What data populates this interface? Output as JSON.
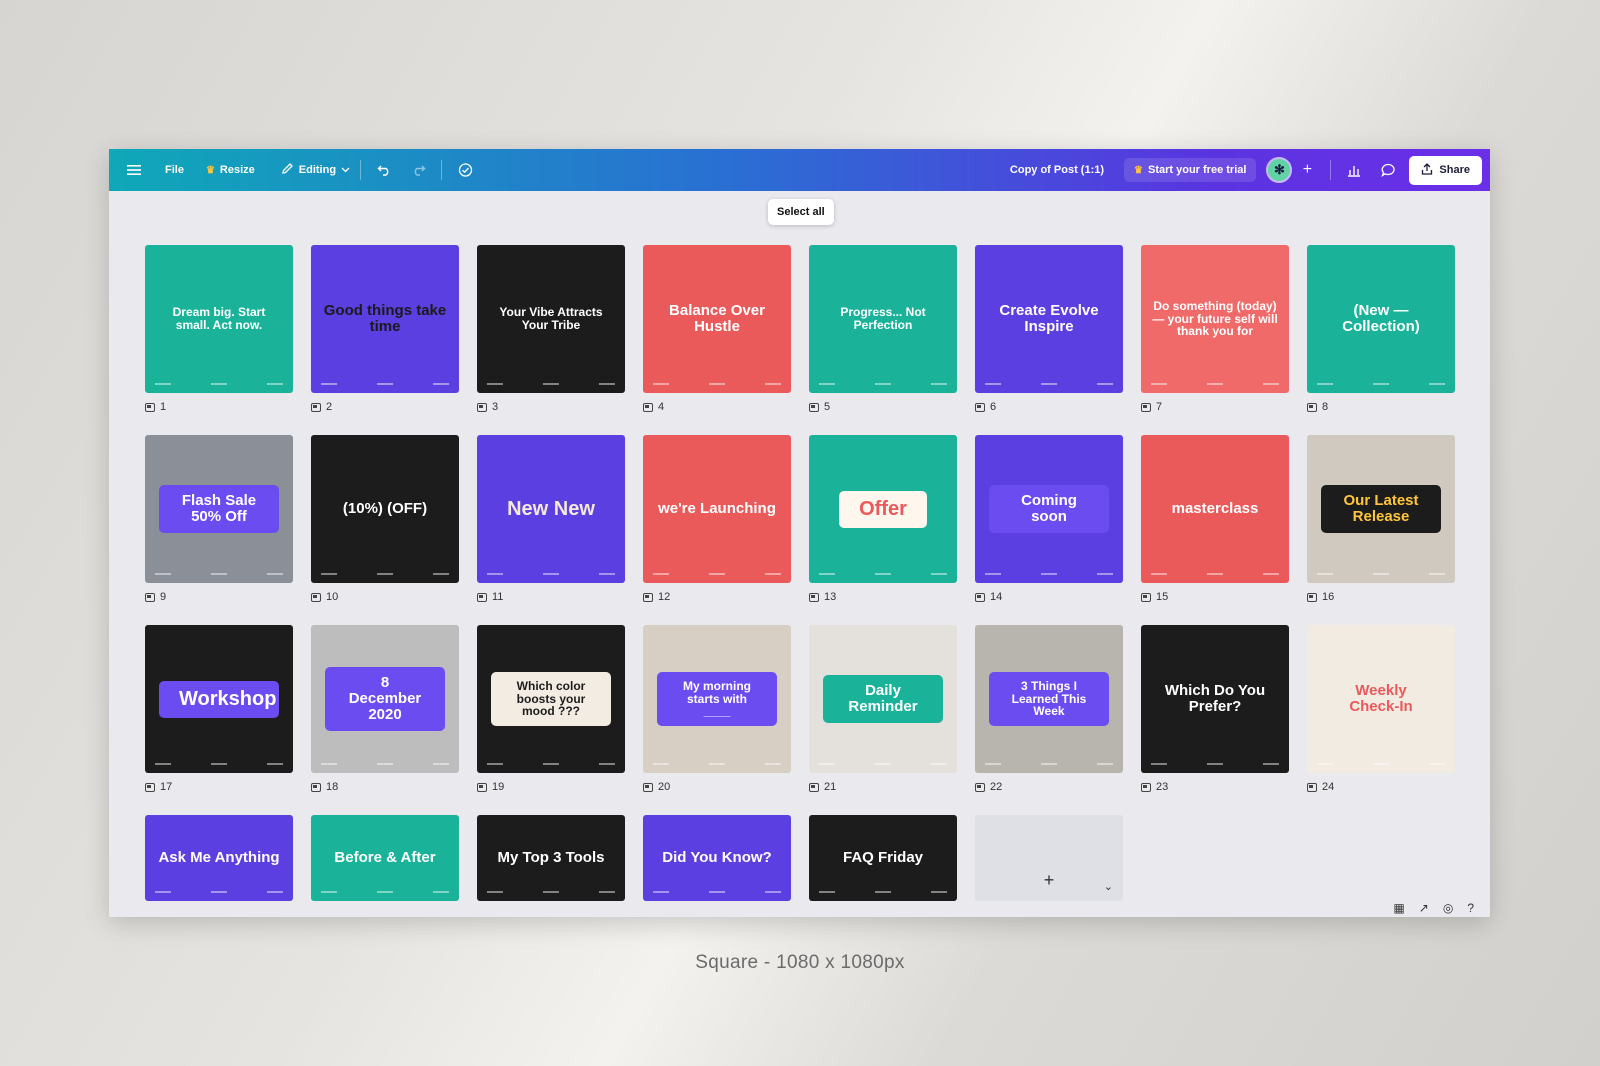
{
  "toolbar": {
    "file": "File",
    "resize": "Resize",
    "editing": "Editing",
    "doc_title": "Copy of Post (1:1)",
    "trial": "Start your free trial",
    "share": "Share"
  },
  "tooltip": "Select all",
  "pages": [
    {
      "num": "1",
      "bg": "#1ab39a",
      "fg": "#ffffff",
      "text": "Dream big. Start small. Act now."
    },
    {
      "num": "2",
      "bg": "#5b3fe0",
      "fg": "#1b1b1b",
      "text": "Good things take time"
    },
    {
      "num": "3",
      "bg": "#1c1c1c",
      "fg": "#ffffff",
      "text": "Your Vibe Attracts Your Tribe"
    },
    {
      "num": "4",
      "bg": "#ea5a5a",
      "fg": "#ffffff",
      "text": "Balance Over Hustle"
    },
    {
      "num": "5",
      "bg": "#1ab39a",
      "fg": "#ffffff",
      "text": "Progress... Not Perfection"
    },
    {
      "num": "6",
      "bg": "#5b3fe0",
      "fg": "#ffffff",
      "text": "Create Evolve Inspire"
    },
    {
      "num": "7",
      "bg": "#ef6a68",
      "fg": "#ffffff",
      "text": "Do something (today) — your future self will thank you for"
    },
    {
      "num": "8",
      "bg": "#1ab39a",
      "fg": "#ffffff",
      "text": "(New — Collection)"
    },
    {
      "num": "9",
      "bg": "#8a8f98",
      "fg": "#ffffff",
      "text": "Flash Sale 50% Off"
    },
    {
      "num": "10",
      "bg": "#1c1c1c",
      "fg": "#ffffff",
      "text": "(10%) (OFF)"
    },
    {
      "num": "11",
      "bg": "#5b3fe0",
      "fg": "#f3e9dc",
      "text": "New New"
    },
    {
      "num": "12",
      "bg": "#ea5a5a",
      "fg": "#ffffff",
      "text": "we're Launching"
    },
    {
      "num": "13",
      "bg": "#1ab39a",
      "fg": "#ea5a5a",
      "text": "Offer"
    },
    {
      "num": "14",
      "bg": "#5b3fe0",
      "fg": "#ffffff",
      "text": "Coming soon"
    },
    {
      "num": "15",
      "bg": "#ea5a5a",
      "fg": "#ffffff",
      "text": "masterclass"
    },
    {
      "num": "16",
      "bg": "#cfc9bf",
      "fg": "#ffc53d",
      "text": "Our Latest Release"
    },
    {
      "num": "17",
      "bg": "#1c1c1c",
      "fg": "#ffffff",
      "text": "Workshop"
    },
    {
      "num": "18",
      "bg": "#bdbdbd",
      "fg": "#ffffff",
      "text": "8 December 2020"
    },
    {
      "num": "19",
      "bg": "#1c1c1c",
      "fg": "#1c1c1c",
      "text": "Which color boosts your mood ???"
    },
    {
      "num": "20",
      "bg": "#d8cfc4",
      "fg": "#ffffff",
      "text": "My morning starts with ____"
    },
    {
      "num": "21",
      "bg": "#e4e0db",
      "fg": "#ffffff",
      "text": "Daily Reminder"
    },
    {
      "num": "22",
      "bg": "#b8b4ae",
      "fg": "#ffffff",
      "text": "3 Things I Learned This Week"
    },
    {
      "num": "23",
      "bg": "#1c1c1c",
      "fg": "#ffffff",
      "text": "Which Do You Prefer?"
    },
    {
      "num": "24",
      "bg": "#f1ebe2",
      "fg": "#ea5a5a",
      "text": "Weekly Check-In"
    },
    {
      "num": "",
      "bg": "#5b3fe0",
      "fg": "#ffffff",
      "text": "Ask Me Anything"
    },
    {
      "num": "",
      "bg": "#1ab39a",
      "fg": "#ffffff",
      "text": "Before & After"
    },
    {
      "num": "",
      "bg": "#1c1c1c",
      "fg": "#ffffff",
      "text": "My Top 3 Tools"
    },
    {
      "num": "",
      "bg": "#5b3fe0",
      "fg": "#ffffff",
      "text": "Did You Know?"
    },
    {
      "num": "",
      "bg": "#1c1c1c",
      "fg": "#ffffff",
      "text": "FAQ Friday"
    }
  ],
  "add_page": "+",
  "caption": "Square - 1080 x 1080px"
}
